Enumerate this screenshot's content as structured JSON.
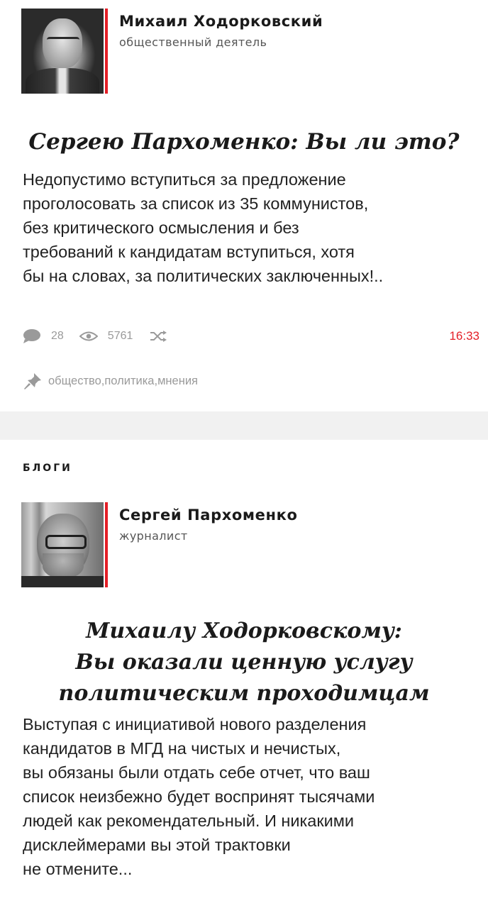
{
  "feed": [
    {
      "author": {
        "name": "Михаил Ходорковский",
        "role": "общественный деятель"
      },
      "headline": [
        "Сергею Пархоменко: Вы ли это?"
      ],
      "lede_lines": [
        "Недопустимо вступиться за предложение",
        "проголосовать за список из 35 коммунистов,",
        "без критического осмысления и без",
        "требований к кандидатам вступиться, хотя",
        "бы на словах, за политических заключенных!.."
      ],
      "stats": {
        "comments": "28",
        "views": "5761",
        "time": "16:33"
      },
      "tags": [
        "общество",
        "политика",
        "мнения"
      ],
      "tag_separator": ", "
    },
    {
      "section_label": "БЛОГИ",
      "author": {
        "name": "Сергей Пархоменко",
        "role": "журналист"
      },
      "headline": [
        "Михаилу Ходорковскому:",
        "Вы оказали ценную услугу",
        "политическим проходимцам"
      ],
      "lede_lines": [
        "Выступая с инициативой нового разделения",
        "кандидатов в МГД на чистых и нечистых,",
        "вы обязаны были отдать себе отчет, что ваш",
        "список неизбежно будет воспринят тысячами",
        "людей как рекомендательный. И никакими",
        "дисклеймерами вы этой трактовки",
        "не отмените..."
      ]
    }
  ],
  "colors": {
    "accent": "#e41e26",
    "muted": "#9a9a9a",
    "divider": "#f1f1f1"
  },
  "icons": {
    "comments": "speech-bubble-icon",
    "views": "eye-icon",
    "share": "shuffle-icon",
    "tags": "pin-icon"
  }
}
